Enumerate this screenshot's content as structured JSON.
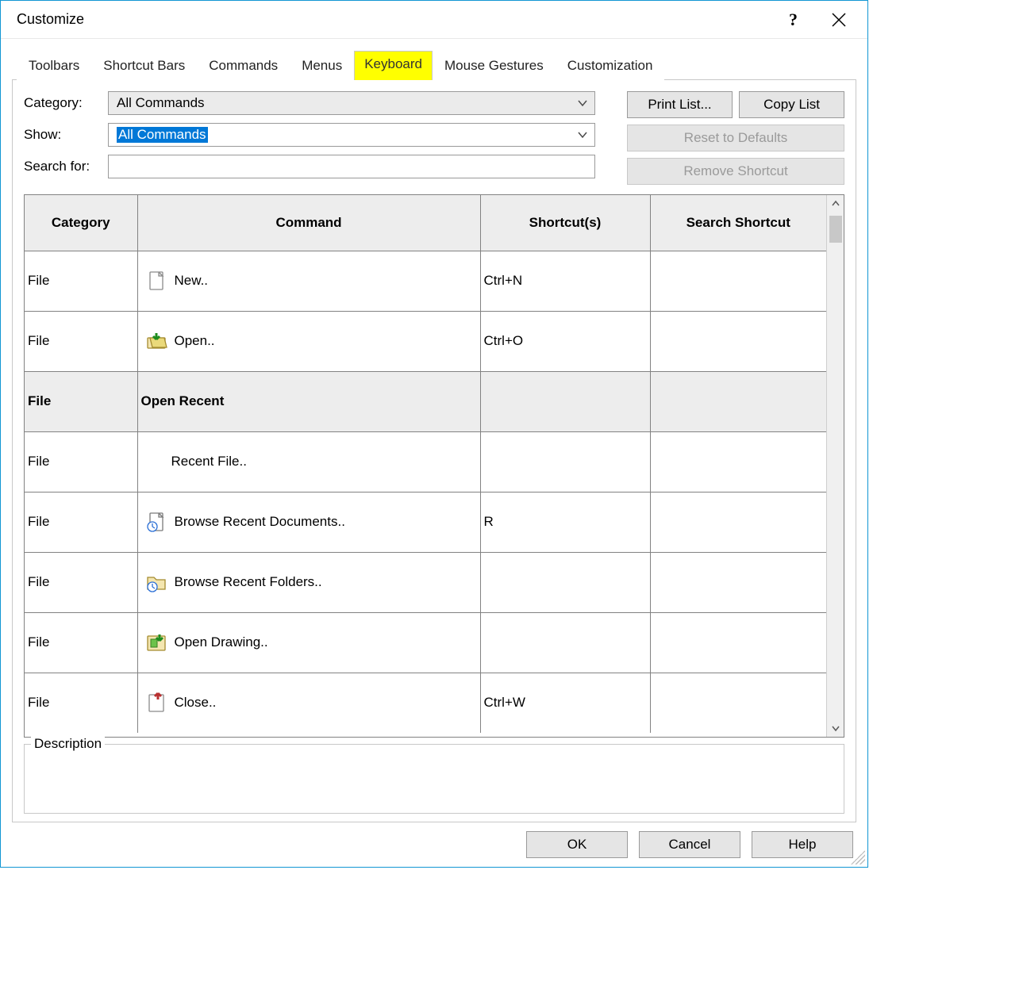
{
  "window": {
    "title": "Customize"
  },
  "tabs": [
    {
      "label": "Toolbars"
    },
    {
      "label": "Shortcut Bars"
    },
    {
      "label": "Commands"
    },
    {
      "label": "Menus"
    },
    {
      "label": "Keyboard"
    },
    {
      "label": "Mouse Gestures"
    },
    {
      "label": "Customization"
    }
  ],
  "labels": {
    "category": "Category:",
    "show": "Show:",
    "search": "Search for:",
    "description": "Description"
  },
  "fields": {
    "category_value": "All Commands",
    "show_value": "All Commands",
    "search_value": ""
  },
  "buttons": {
    "print_list": "Print List...",
    "copy_list": "Copy List",
    "reset": "Reset to Defaults",
    "remove_shortcut": "Remove Shortcut",
    "ok": "OK",
    "cancel": "Cancel",
    "help": "Help"
  },
  "columns": [
    "Category",
    "Command",
    "Shortcut(s)",
    "Search Shortcut"
  ],
  "rows": [
    {
      "category": "File",
      "command": "New..",
      "shortcut": "Ctrl+N",
      "search": "",
      "icon": "doc",
      "group": false,
      "indent": false
    },
    {
      "category": "File",
      "command": "Open..",
      "shortcut": "Ctrl+O",
      "search": "",
      "icon": "open",
      "group": false,
      "indent": false
    },
    {
      "category": "File",
      "command": "Open Recent",
      "shortcut": "",
      "search": "",
      "icon": "",
      "group": true,
      "indent": false
    },
    {
      "category": "File",
      "command": "Recent File..",
      "shortcut": "",
      "search": "",
      "icon": "",
      "group": false,
      "indent": true
    },
    {
      "category": "File",
      "command": "Browse Recent Documents..",
      "shortcut": "R",
      "search": "",
      "icon": "doc-clock",
      "group": false,
      "indent": false
    },
    {
      "category": "File",
      "command": "Browse Recent Folders..",
      "shortcut": "",
      "search": "",
      "icon": "folder-clock",
      "group": false,
      "indent": false
    },
    {
      "category": "File",
      "command": "Open Drawing..",
      "shortcut": "",
      "search": "",
      "icon": "drawing",
      "group": false,
      "indent": false
    },
    {
      "category": "File",
      "command": "Close..",
      "shortcut": "Ctrl+W",
      "search": "",
      "icon": "close-doc",
      "group": false,
      "indent": false
    }
  ]
}
